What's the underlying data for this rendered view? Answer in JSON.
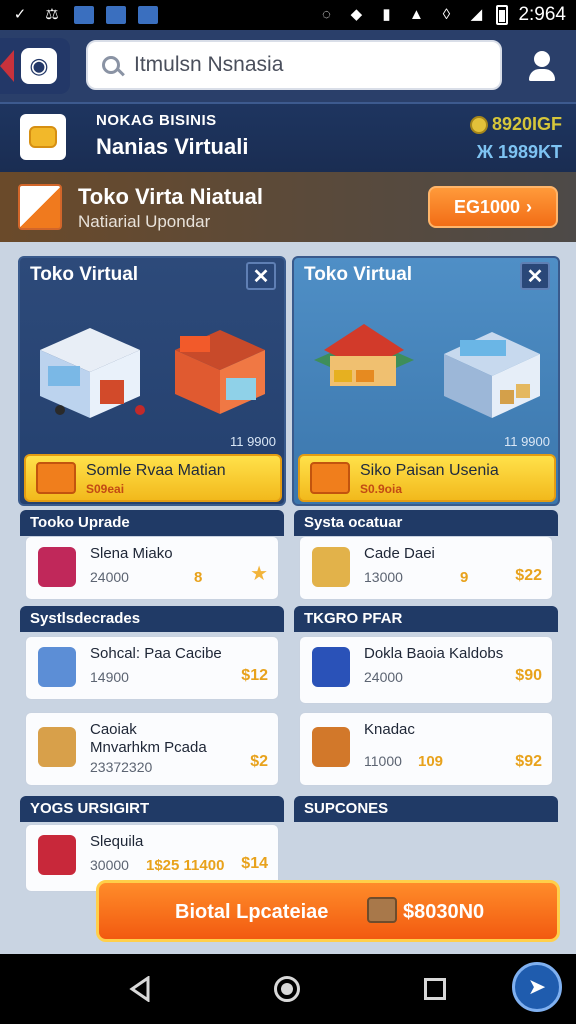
{
  "status_bar": {
    "time": "2:964",
    "icons": [
      "notification-icon",
      "notification-icon",
      "image-icon",
      "mail-icon",
      "calendar-icon",
      "sync-icon",
      "alarm-icon",
      "nfc-icon",
      "wifi-icon",
      "signal-icon",
      "battery-icon"
    ]
  },
  "header": {
    "search_placeholder": "Itmulsn Nsnasia"
  },
  "business": {
    "subtitle": "NOKAG BISINIS",
    "name": "Nanias Virtuali",
    "stat_coins": "8920IGF",
    "stat_gems": "Ж 1989KT"
  },
  "store_banner": {
    "title": "Toko Virta Niatual",
    "subtitle": "Natiarial Upondar",
    "button_label": "EG1000"
  },
  "store_cards": [
    {
      "title": "Toko Virtual",
      "count": "11 9900",
      "offer_title": "Somle Rvaa Matian",
      "offer_price": "S09eai"
    },
    {
      "title": "Toko Virtual",
      "count": "11 9900",
      "offer_title": "Siko Paisan Usenia",
      "offer_price": "S0.9oia"
    }
  ],
  "sections": [
    {
      "heading": "Tooko Uprade",
      "items": [
        {
          "name": "Slena Miako",
          "sub": "24000",
          "meta": "8",
          "price": ""
        }
      ]
    },
    {
      "heading": "Systa ocatuar",
      "items": [
        {
          "name": "Cade Daei",
          "sub": "13000",
          "meta": "9",
          "price": "$22"
        }
      ]
    },
    {
      "heading": "Systlsdecrades",
      "items": [
        {
          "name": "Sohcal: Paa Cacibe",
          "sub": "14900",
          "meta": "",
          "price": "$12"
        },
        {
          "name": "Caoiak",
          "name2": "Mnvarhkm Pcada",
          "sub": "23372320",
          "meta": "",
          "price": "$2"
        }
      ]
    },
    {
      "heading": "TKGRO PFAR",
      "items": [
        {
          "name": "Dokla Baoia Kaldobs",
          "sub": "24000",
          "meta": "",
          "price": "$90"
        },
        {
          "name": "Knadac",
          "sub": "11000",
          "meta": "109",
          "price": "$92"
        }
      ]
    },
    {
      "heading": "YOGS URSIGIRT",
      "items": [
        {
          "name": "Slequila",
          "sub": "30000",
          "meta": "1$25 11400",
          "price": "$14"
        }
      ]
    },
    {
      "heading": "SUPCONES",
      "items": []
    }
  ],
  "cta": {
    "label": "Biotal Lpcateiae",
    "amount": "$8030N0"
  },
  "colors": {
    "header": "#2a3f6a",
    "accent_orange": "#f26d16",
    "offer_yellow": "#f2b91c",
    "price_gold": "#e8a21c"
  }
}
